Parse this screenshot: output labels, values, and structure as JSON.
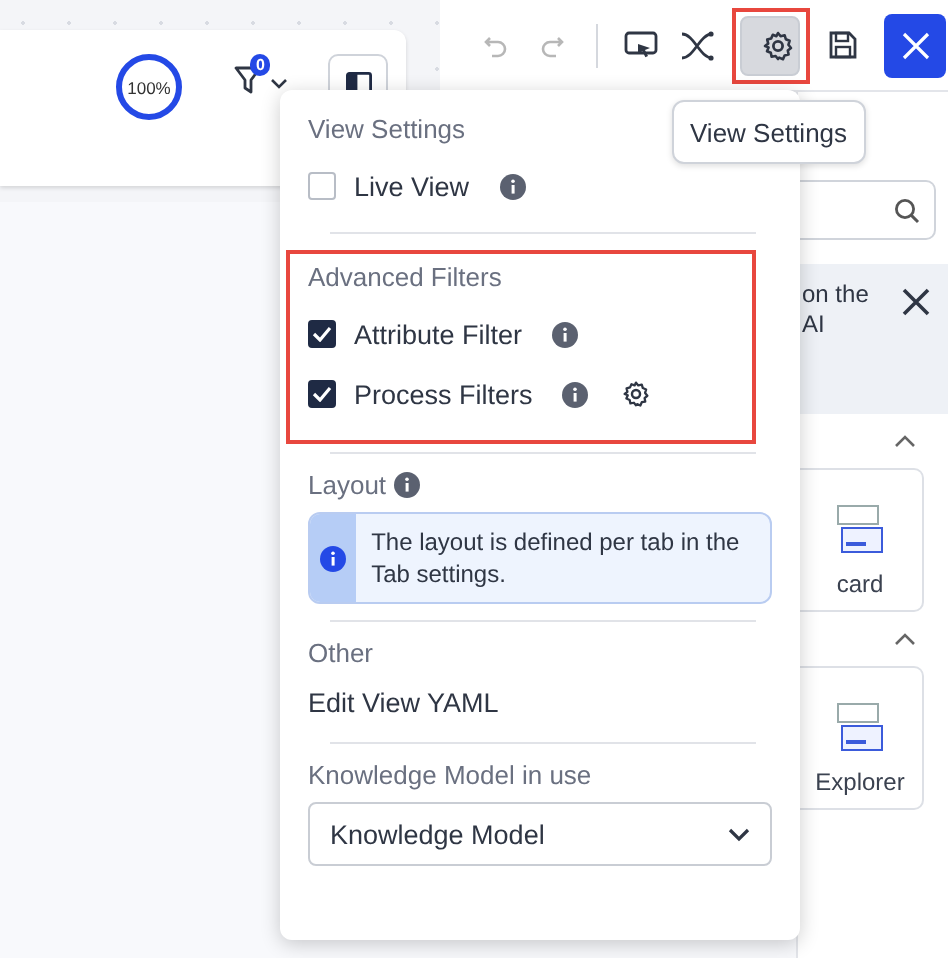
{
  "canvas_toolbar": {
    "zoom": "100%",
    "filter_badge": "0"
  },
  "actions": [
    {
      "kind": "undo",
      "disabled": true,
      "selected": false,
      "highlighted": false
    },
    {
      "kind": "redo",
      "disabled": true,
      "selected": false,
      "highlighted": false
    },
    {
      "kind": "present",
      "disabled": false,
      "selected": false,
      "highlighted": false
    },
    {
      "kind": "shuffle",
      "disabled": false,
      "selected": false,
      "highlighted": false
    },
    {
      "kind": "settings",
      "disabled": false,
      "selected": true,
      "highlighted": true
    },
    {
      "kind": "save",
      "disabled": false,
      "selected": false,
      "highlighted": false
    },
    {
      "kind": "close",
      "disabled": false,
      "selected": false,
      "highlighted": false
    }
  ],
  "tooltip": "View Settings",
  "side_panel": {
    "banner_lines": [
      "on the",
      "AI"
    ],
    "cards": [
      {
        "label": "card"
      },
      {
        "label": "Explorer"
      }
    ]
  },
  "view_settings": {
    "sections": [
      {
        "title": "View Settings",
        "title_info": false,
        "highlighted": false,
        "items": [
          {
            "kind": "checkbox",
            "label": "Live View",
            "checked": false,
            "info": true,
            "settings": false
          }
        ]
      },
      {
        "title": "Advanced Filters",
        "title_info": false,
        "highlighted": true,
        "items": [
          {
            "kind": "checkbox",
            "label": "Attribute Filter",
            "checked": true,
            "info": true,
            "settings": false
          },
          {
            "kind": "checkbox",
            "label": "Process Filters",
            "checked": true,
            "info": true,
            "settings": true
          }
        ]
      },
      {
        "title": "Layout",
        "title_info": true,
        "highlighted": false,
        "items": [
          {
            "kind": "note",
            "text": "The layout is defined per tab in the Tab settings."
          }
        ]
      },
      {
        "title": "Other",
        "title_info": false,
        "highlighted": false,
        "items": [
          {
            "kind": "link",
            "label": "Edit View YAML"
          }
        ]
      },
      {
        "title": "Knowledge Model in use",
        "title_info": false,
        "highlighted": false,
        "items": [
          {
            "kind": "select",
            "value": "Knowledge Model"
          }
        ]
      }
    ]
  }
}
